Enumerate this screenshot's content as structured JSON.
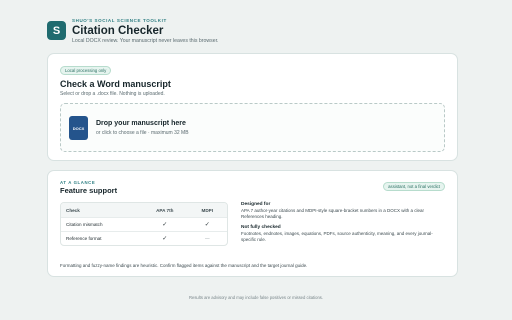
{
  "header": {
    "logo_letter": "S",
    "kicker": "SHUO'S SOCIAL SCIENCE TOOLKIT",
    "title": "Citation Checker",
    "subtitle": "Local DOCX review. Your manuscript never leaves this browser."
  },
  "upload": {
    "badge": "Local processing only",
    "title": "Check a Word manuscript",
    "hint": "Select or drop a .docx file. Nothing is uploaded.",
    "dropzone": {
      "file_icon_label": "DOCX",
      "title": "Drop your manuscript here",
      "subtitle": "or click to choose a file · maximum 32 MB"
    }
  },
  "features": {
    "kicker": "AT A GLANCE",
    "title": "Feature support",
    "badge": "assistant, not a final verdict",
    "table": {
      "headers": [
        "Check",
        "APA 7th",
        "MDPI"
      ],
      "rows": [
        {
          "check": "Citation mismatch",
          "apa": "✓",
          "mdpi": "✓"
        },
        {
          "check": "Reference format",
          "apa": "✓",
          "mdpi": "—"
        }
      ]
    },
    "designed_for_heading": "Designed for",
    "designed_for_text": "APA 7 author-year citations and MDPI-style square-bracket numbers in a DOCX with a clear References heading.",
    "not_checked_heading": "Not fully checked",
    "not_checked_text": "Footnotes, endnotes, images, equations, PDFs, source authenticity, meaning, and every journal-specific rule.",
    "footnote": "Formatting and fuzzy-name findings are heuristic. Confirm flagged items against the manuscript and the target journal guide."
  },
  "footer": {
    "text": "Results are advisory and may include false positives or missed citations."
  },
  "colors": {
    "brand": "#1f6b6f",
    "docx_icon": "#24548c",
    "background": "#eef2f1"
  }
}
